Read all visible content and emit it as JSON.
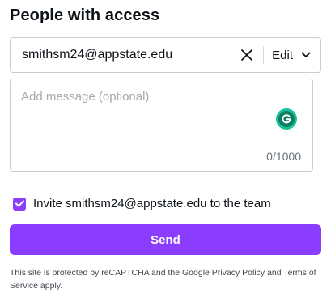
{
  "title": "People with access",
  "email_input": {
    "value": "smithsm24@appstate.edu"
  },
  "permission": {
    "selected": "Edit"
  },
  "message": {
    "placeholder": "Add message (optional)",
    "counter": "0/1000"
  },
  "invite": {
    "label": "Invite smithsm24@appstate.edu to the team",
    "checked": true
  },
  "send_label": "Send",
  "legal": {
    "prefix": "This site is protected by reCAPTCHA and the Google ",
    "privacy_link": "Privacy Policy",
    "middle": " and ",
    "terms_link": "Terms of Service",
    "suffix": " apply."
  },
  "colors": {
    "accent": "#8b3dff",
    "grammarly": "#15c39a"
  },
  "icons": {
    "clear": "close-icon",
    "dropdown": "chevron-down-icon",
    "grammarly": "grammarly-icon",
    "check": "checkmark-icon"
  }
}
